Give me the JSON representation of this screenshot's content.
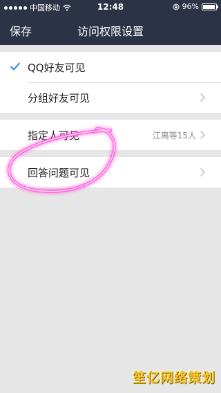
{
  "status_bar": {
    "carrier": "中国移动",
    "time": "12:48",
    "battery_percent": "96%",
    "battery_level": 0.96
  },
  "nav": {
    "save_label": "保存",
    "title": "访问权限设置"
  },
  "options": [
    {
      "label": "QQ好友可见",
      "selected": true
    },
    {
      "label": "分组好友可见",
      "selected": false
    },
    {
      "label": "指定人可见",
      "detail": "江离等15人",
      "selected": false
    },
    {
      "label": "回答问题可见",
      "selected": false
    }
  ],
  "colors": {
    "nav_background": "#2c3346",
    "check": "#2a8bd6",
    "highlight": "#ff4fd8"
  },
  "watermark": "笙亿网络策划"
}
